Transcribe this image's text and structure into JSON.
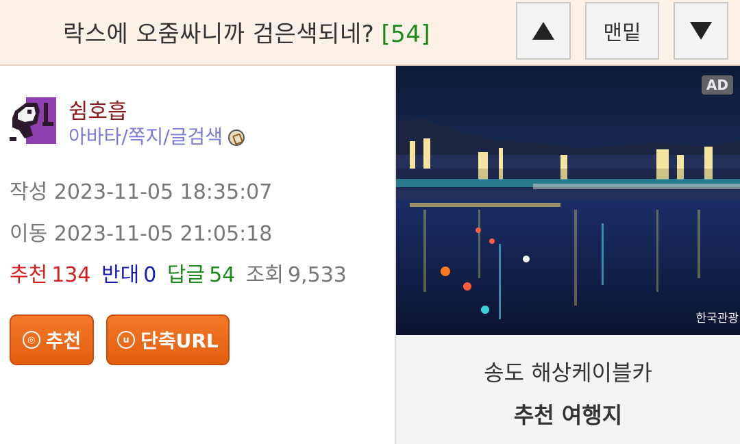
{
  "header": {
    "title": "락스에 오줌싸니까 검은색되네?",
    "reply_count": "[54]",
    "up_icon": "triangle-up",
    "bottom_label": "맨밑",
    "down_icon": "triangle-down"
  },
  "author": {
    "name": "쉼호흡",
    "links": "아바타/쪽지/글검색",
    "avatar_icon": "purple-creature-avatar",
    "badge_icon": "coin-icon"
  },
  "meta": {
    "written": "작성 2023-11-05 18:35:07",
    "moved": "이동 2023-11-05 21:05:18"
  },
  "stats": {
    "recommend_label": "추천",
    "recommend_value": "134",
    "oppose_label": "반대",
    "oppose_value": "0",
    "reply_label": "답글",
    "reply_value": "54",
    "view_label": "조회",
    "view_value": "9,533"
  },
  "buttons": {
    "recommend": "추천",
    "recommend_icon": "◎",
    "short_url": "단축URL",
    "short_url_icon": "u"
  },
  "ad": {
    "badge": "AD",
    "title": "송도 해상케이블카",
    "subtitle": "추천 여행지",
    "logo_text": "한국관광"
  },
  "colors": {
    "header_bg": "#fbf1e7",
    "count": "#1a8a1a",
    "author": "#8b1a1a",
    "links": "#7a7ad6",
    "recommend": "#d42020",
    "oppose": "#1a1ab8",
    "reply": "#1a8a1a",
    "button": "#e8621a"
  }
}
